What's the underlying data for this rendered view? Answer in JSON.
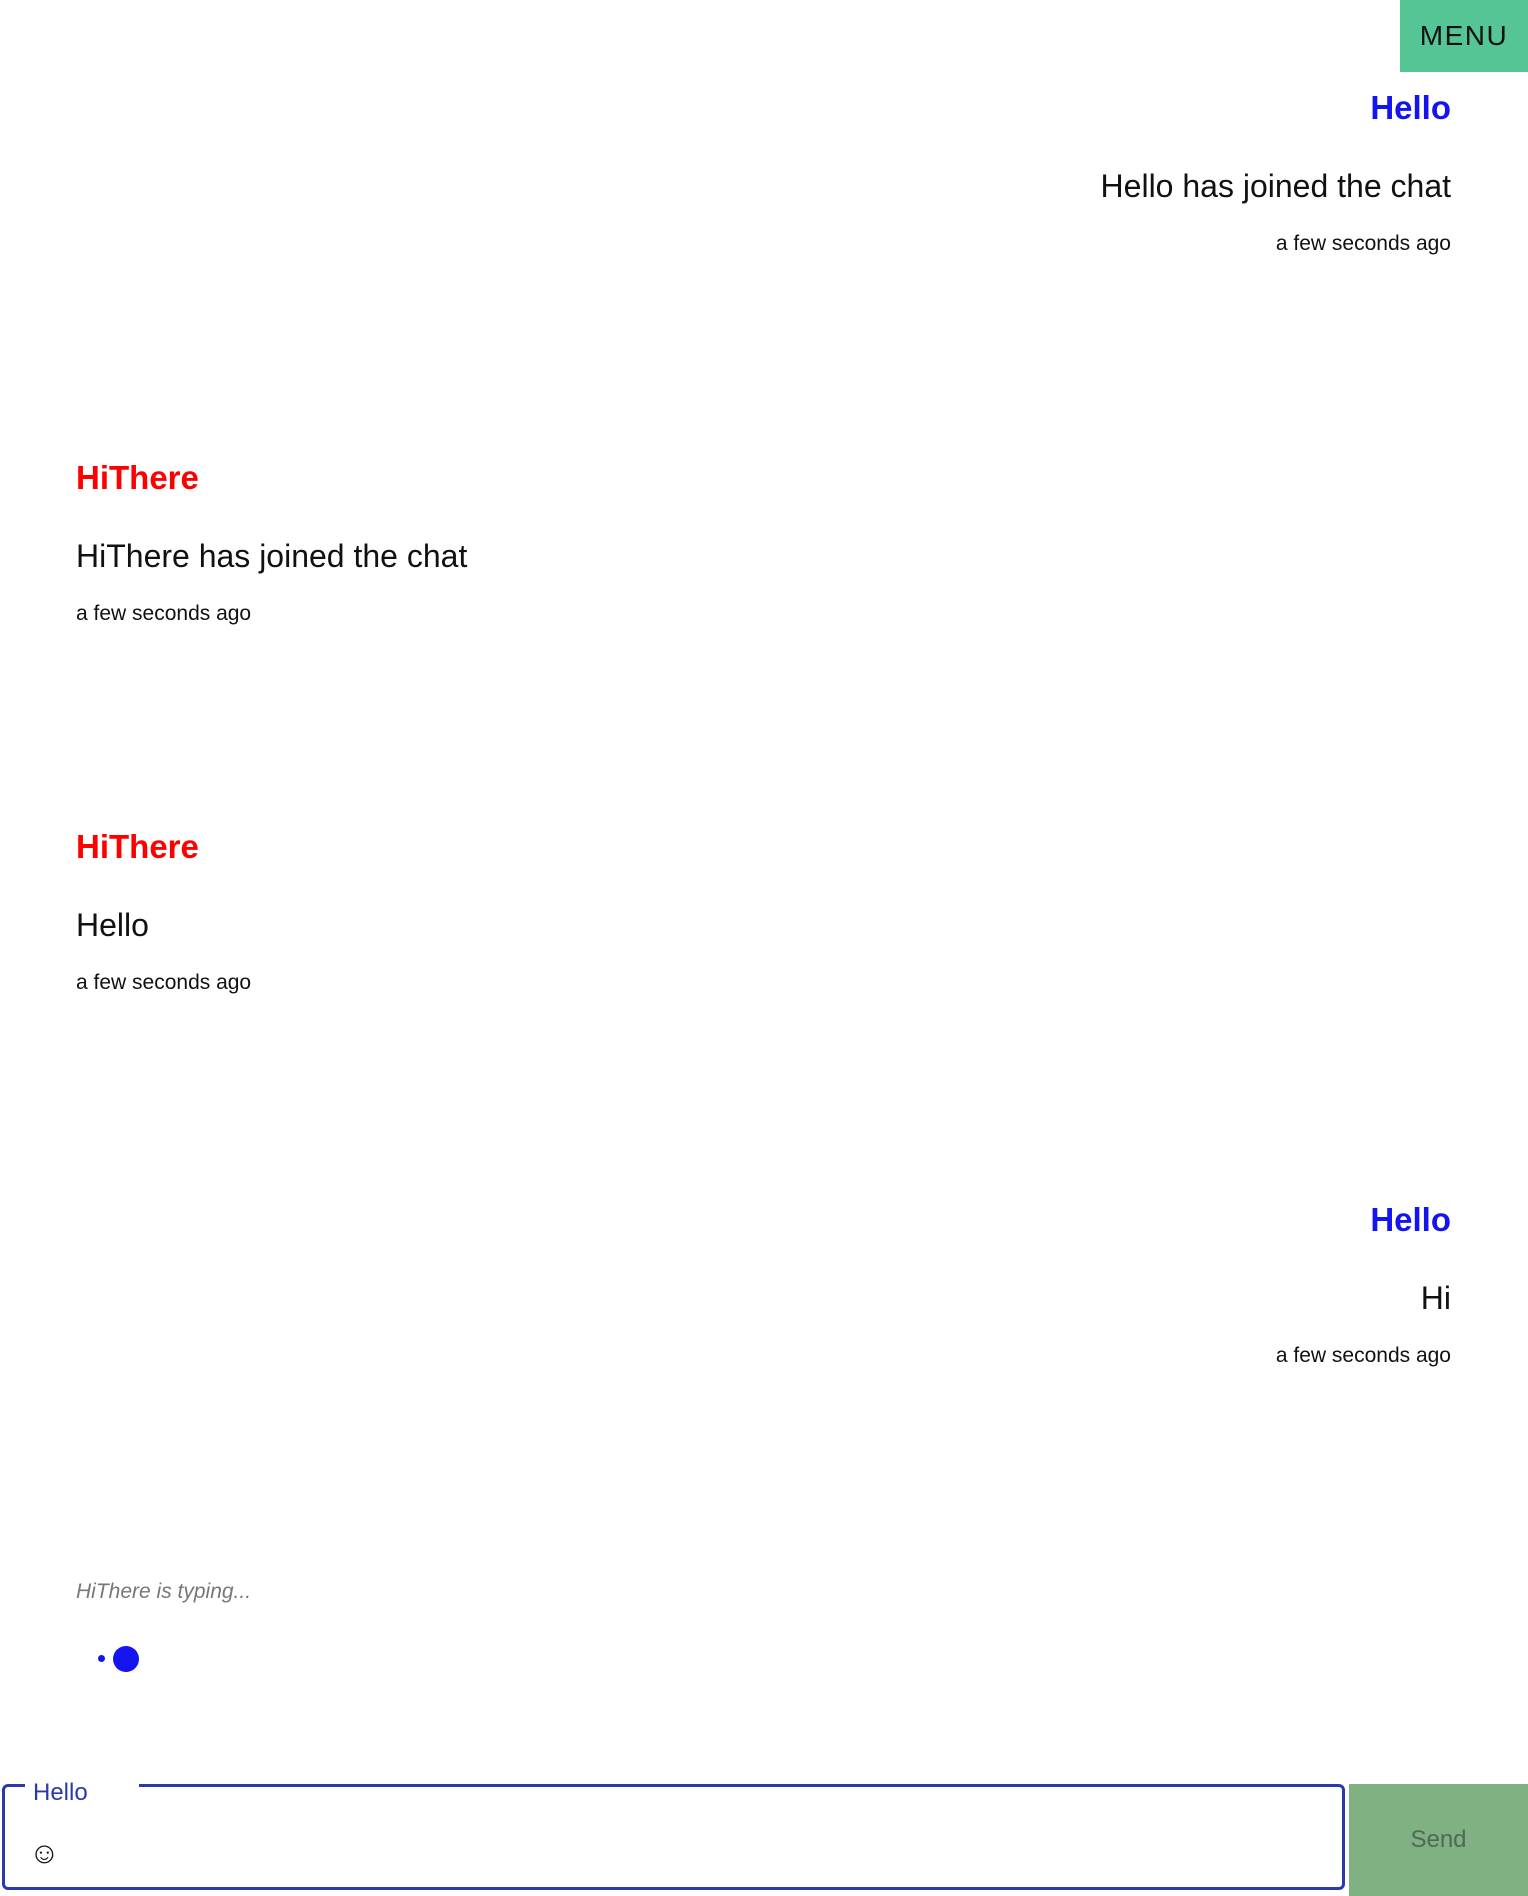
{
  "header": {
    "menu_label": "MENU"
  },
  "messages": [
    {
      "author": "Hello",
      "text": "Hello has joined the chat",
      "time": "a few seconds ago",
      "side": "right"
    },
    {
      "author": "HiThere",
      "text": "HiThere has joined the chat",
      "time": "a few seconds ago",
      "side": "left"
    },
    {
      "author": "HiThere",
      "text": "Hello",
      "time": "a few seconds ago",
      "side": "left"
    },
    {
      "author": "Hello",
      "text": "Hi",
      "time": "a few seconds ago",
      "side": "right"
    }
  ],
  "typing": {
    "text": "HiThere is typing..."
  },
  "composer": {
    "label": "Hello",
    "emoji_icon": "smiley-icon",
    "emoji_glyph": "☺",
    "value": "",
    "send_label": "Send"
  },
  "colors": {
    "self_author": "#1414f0",
    "other_author": "#ff0000",
    "menu_bg": "#55c596",
    "send_bg": "#80b183",
    "input_border": "#2a3aa8"
  }
}
